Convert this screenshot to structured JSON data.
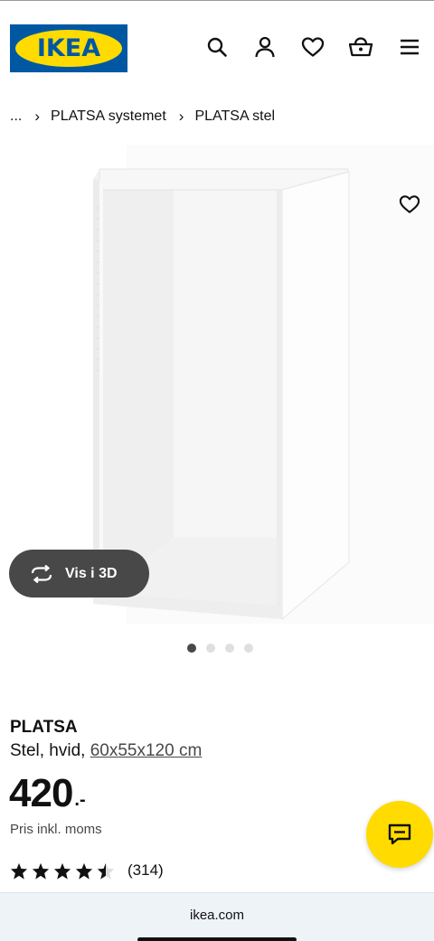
{
  "header": {
    "logo_text": "IKEA",
    "icons": [
      "search-icon",
      "user-icon",
      "heart-icon",
      "basket-icon",
      "menu-icon"
    ],
    "brand_blue": "#0058a3",
    "brand_yellow": "#ffdb00"
  },
  "breadcrumb": {
    "ellipsis": "...",
    "separator": "›",
    "items": [
      "PLATSA systemet",
      "PLATSA stel"
    ]
  },
  "gallery": {
    "view_3d_label": "Vis i 3D",
    "image_count": 4,
    "active_image": 1
  },
  "product": {
    "name": "PLATSA",
    "description": "Stel, hvid,",
    "dimensions": "60x55x120 cm",
    "price": "420",
    "price_suffix": ".-",
    "price_note": "Pris inkl. moms",
    "rating": 4.5,
    "review_count": "(314)"
  },
  "browser": {
    "url": "ikea.com"
  }
}
